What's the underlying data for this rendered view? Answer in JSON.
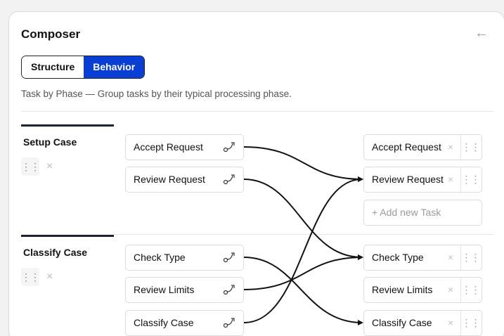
{
  "header": {
    "title": "Composer",
    "back_icon": "arrow-left-icon"
  },
  "mode_toggle": {
    "options": [
      "Structure",
      "Behavior"
    ],
    "selected": "Behavior"
  },
  "description": "Task by Phase — Group tasks by their typical processing phase.",
  "phases": [
    {
      "name": "Setup Case",
      "tasks": [
        "Accept Request",
        "Review Request"
      ]
    },
    {
      "name": "Classify Case",
      "tasks": [
        "Check Type",
        "Review Limits",
        "Classify Case"
      ]
    }
  ],
  "targets": [
    {
      "label": "Accept Request"
    },
    {
      "label": "Review Request"
    },
    {
      "label": "Check Type"
    },
    {
      "label": "Review Limits"
    },
    {
      "label": "Classify Case"
    }
  ],
  "add_task_placeholder": "+ Add new Task",
  "connections": [
    {
      "from": "Accept Request",
      "to": "Review Request"
    },
    {
      "from": "Review Request",
      "to": "Check Type"
    },
    {
      "from": "Check Type",
      "to": "Classify Case"
    },
    {
      "from": "Review Limits",
      "to": "Check Type"
    },
    {
      "from": "Classify Case",
      "to": "Review Request"
    }
  ],
  "colors": {
    "accent": "#0a3fd6",
    "phase_bar": "#1c2230",
    "wire": "#111111"
  }
}
